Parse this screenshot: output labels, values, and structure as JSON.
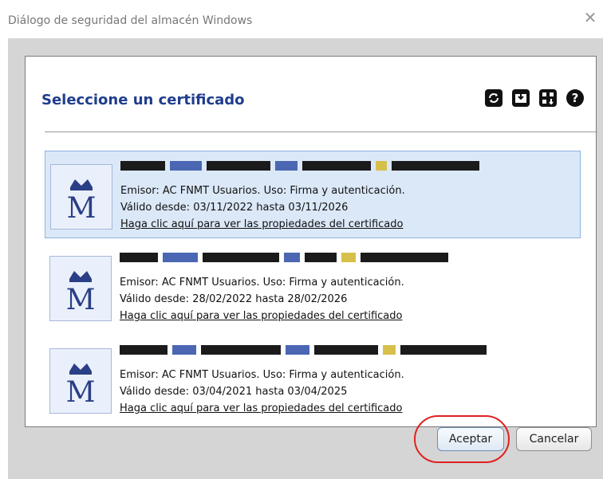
{
  "window": {
    "title": "Diálogo de seguridad del almacén Windows"
  },
  "dialog": {
    "heading": "Seleccione un certificado",
    "toolbar_icons": [
      "refresh-icon",
      "import-icon",
      "export-icon",
      "help-icon"
    ]
  },
  "certificates": [
    {
      "issuer": "Emisor: AC FNMT Usuarios. Uso: Firma y autenticación.",
      "validity": "Válido desde: 03/11/2022 hasta 03/11/2026",
      "link": "Haga clic aquí para ver las propiedades del certificado",
      "selected": true
    },
    {
      "issuer": "Emisor: AC FNMT Usuarios. Uso: Firma y autenticación.",
      "validity": "Válido desde: 28/02/2022 hasta 28/02/2026",
      "link": "Haga clic aquí para ver las propiedades del certificado",
      "selected": false
    },
    {
      "issuer": "Emisor: AC FNMT Usuarios. Uso: Firma y autenticación.",
      "validity": "Válido desde: 03/04/2021 hasta 03/04/2025",
      "link": "Haga clic aquí para ver las propiedades del certificado",
      "selected": false
    }
  ],
  "buttons": {
    "accept": "Aceptar",
    "cancel": "Cancelar"
  },
  "colors": {
    "heading": "#1f3d8c",
    "selection": "#dbe8f8",
    "highlight_ring": "#e02020"
  }
}
